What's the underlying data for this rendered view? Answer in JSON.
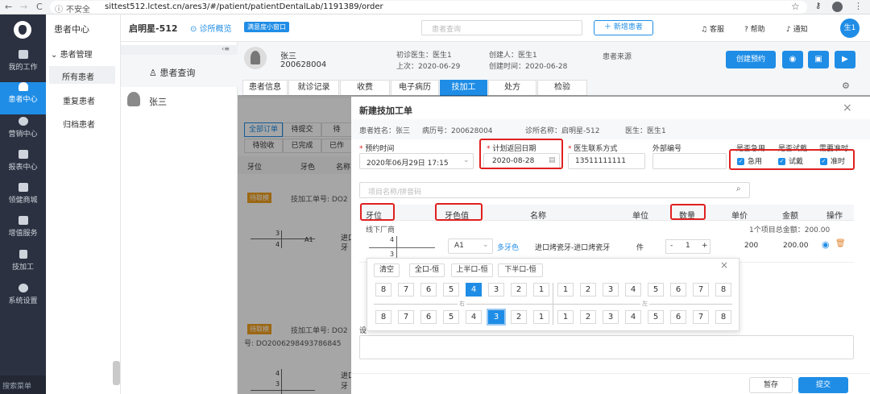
{
  "browser": {
    "back": "←",
    "forward": "→",
    "reload": "C",
    "security": "不安全",
    "url": "sittest512.lctest.cn/ares3/#/patient/patientDentalLab/1191389/order",
    "star": "☆"
  },
  "sidebar": {
    "items": [
      {
        "label": "我的工作"
      },
      {
        "label": "患者中心"
      },
      {
        "label": "营销中心"
      },
      {
        "label": "报表中心"
      },
      {
        "label": "领健商城"
      },
      {
        "label": "增值服务"
      },
      {
        "label": "技加工"
      },
      {
        "label": "系统设置"
      }
    ],
    "bottom": "搜索菜单"
  },
  "subnav": {
    "title": "患者中心",
    "group": "患者管理",
    "items": [
      "所有患者",
      "重复患者",
      "归档患者"
    ]
  },
  "header": {
    "clinic": "启明星-512",
    "overview": "诊所概览",
    "badge": "满意度小窗口",
    "search_placeholder": "患者查询",
    "add_patient": "新增患者",
    "service": "客服",
    "help": "帮助",
    "notify": "通知",
    "avatar": "生1"
  },
  "qcol": {
    "title": "患者查询",
    "patient": "张三",
    "collapse": "‹≡"
  },
  "patient": {
    "name": "张三",
    "id": "200628004",
    "first_doctor": "初诊医生：医生1",
    "creator": "创建人：医生1",
    "last_visit": "上次：2020-06-29",
    "created": "创建时间：2020-06-28",
    "source": "患者来源",
    "create_appt": "创建预约"
  },
  "tabs": [
    "患者信息",
    "就诊记录",
    "收费",
    "电子病历",
    "技加工",
    "处方",
    "检验"
  ],
  "order_bg": {
    "tabs": [
      "全部订单",
      "待提交",
      "待"
    ],
    "tabs2": [
      "待验收",
      "已完成",
      "已作"
    ],
    "col_tooth": "牙位",
    "col_color": "牙色",
    "col_name": "名称",
    "tag1": "待取模",
    "order1": "技加工单号: DO2",
    "tag2": "待取模",
    "order2": "技加工单号: DO2",
    "order2b": "号: DO2006298493786845",
    "entry_a": "进口",
    "entry_b": "牙",
    "t_top": "3",
    "t_bottom": "4",
    "t_a1": "A1",
    "t_top2": "4",
    "t_bottom2": "3",
    "up": "上"
  },
  "modal": {
    "title": "新建技加工单",
    "info": {
      "name": "患者姓名：张三",
      "record": "病历号：200628004",
      "clinic": "诊所名称：启明星-512",
      "doctor": "医生：医生1"
    },
    "labels": {
      "appt": "预约时间",
      "return": "计划返回日期",
      "phone": "医生联系方式",
      "ext": "外部编号",
      "urgent": "是否急用",
      "trial": "是否试戴",
      "ontime": "需要准时"
    },
    "values": {
      "appt": "2020年06月29日 17:15",
      "return": "2020-08-28",
      "phone": "13511111111"
    },
    "checks": {
      "urgent": "急用",
      "trial": "试戴",
      "ontime": "准时"
    },
    "search_placeholder": "项目名称/拼音码",
    "cols": {
      "tooth": "牙位",
      "color": "牙色值",
      "name": "名称",
      "unit": "单位",
      "qty": "数量",
      "price": "单价",
      "amount": "金额",
      "op": "操作"
    },
    "factory": "线下厂商",
    "summary": "1个项目总金额：200.00",
    "row": {
      "t_top": "4",
      "t_bottom": "3",
      "color": "A1",
      "color_link": "多牙色",
      "name": "进口烤瓷牙-进口烤瓷牙",
      "unit": "件",
      "qty": "1",
      "minus": "-",
      "plus": "+",
      "price": "200",
      "amount": "200.00"
    },
    "set_label": "设",
    "cancel": "暂存",
    "submit": "提交"
  },
  "picker": {
    "buttons": [
      "清空",
      "全口-恒",
      "上半口-恒",
      "下半口-恒"
    ],
    "right_label": "右",
    "left_label": "左",
    "upper_right": [
      "8",
      "7",
      "6",
      "5",
      "4",
      "3",
      "2",
      "1"
    ],
    "upper_left": [
      "1",
      "2",
      "3",
      "4",
      "5",
      "6",
      "7",
      "8"
    ],
    "lower_right": [
      "8",
      "7",
      "6",
      "5",
      "4",
      "3",
      "2",
      "1"
    ],
    "lower_left": [
      "1",
      "2",
      "3",
      "4",
      "5",
      "6",
      "7",
      "8"
    ],
    "selected_upper": "4",
    "selected_lower": "3"
  },
  "colors": {
    "accent": "#1f8de6",
    "highlight": "#e02020",
    "sidebar": "#2b3140"
  }
}
